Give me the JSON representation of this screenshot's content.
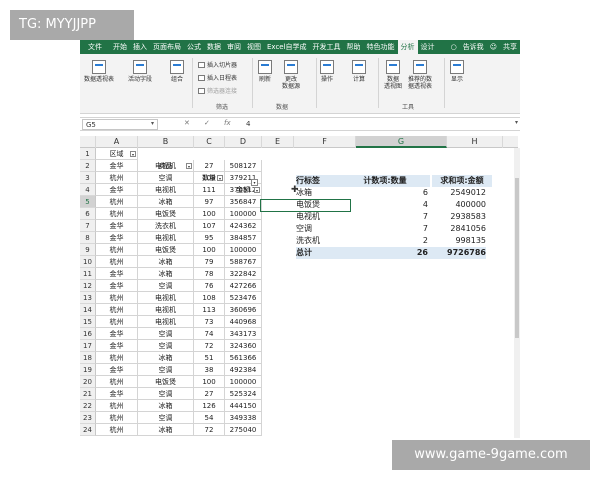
{
  "watermark_top": "TG: MYYJJPP",
  "watermark_bottom": "www.game-9game.com",
  "tabs": [
    "文件",
    "开始",
    "插入",
    "页面布局",
    "公式",
    "数据",
    "审阅",
    "视图",
    "Excel自学成",
    "开发工具",
    "帮助",
    "特色功能",
    "分析",
    "设计"
  ],
  "tab_active": "分析",
  "tab_tell": "告诉我",
  "tab_share": "共享",
  "ribbon": {
    "pivot_table": "数据透视表",
    "active_field": "活动字段",
    "group": "组合",
    "insert_slicer": "插入切片器",
    "insert_timeline": "插入日程表",
    "filter_connections": "筛选器连接",
    "filter_group": "筛选",
    "refresh": "刷新",
    "change_source": "更改\n数据源",
    "data_group": "数据",
    "actions": "操作",
    "calculations": "计算",
    "pivot_chart": "数据\n透视图",
    "recommended": "推荐的数\n据透视表",
    "tools_group": "工具",
    "show": "显示"
  },
  "formula_bar": {
    "name_box": "G5",
    "fx": "fx",
    "value": "4"
  },
  "columns": [
    "A",
    "B",
    "C",
    "D",
    "E",
    "F",
    "G",
    "H"
  ],
  "selected_column": "G",
  "selected_row": "5",
  "headers": {
    "region": "区域",
    "product": "商品",
    "qty": "数量",
    "amount": "金额"
  },
  "rows": [
    {
      "n": "2",
      "region": "金华",
      "product": "电视机",
      "qty": "27",
      "amount": "508127"
    },
    {
      "n": "3",
      "region": "杭州",
      "product": "空调",
      "qty": "109",
      "amount": "379211"
    },
    {
      "n": "4",
      "region": "金华",
      "product": "电视机",
      "qty": "111",
      "amount": "376512"
    },
    {
      "n": "5",
      "region": "杭州",
      "product": "冰箱",
      "qty": "97",
      "amount": "356847"
    },
    {
      "n": "6",
      "region": "杭州",
      "product": "电饭煲",
      "qty": "100",
      "amount": "100000"
    },
    {
      "n": "7",
      "region": "金华",
      "product": "洗衣机",
      "qty": "107",
      "amount": "424362"
    },
    {
      "n": "8",
      "region": "金华",
      "product": "电视机",
      "qty": "95",
      "amount": "384857"
    },
    {
      "n": "9",
      "region": "杭州",
      "product": "电饭煲",
      "qty": "100",
      "amount": "100000"
    },
    {
      "n": "10",
      "region": "杭州",
      "product": "冰箱",
      "qty": "79",
      "amount": "588767"
    },
    {
      "n": "11",
      "region": "金华",
      "product": "冰箱",
      "qty": "78",
      "amount": "322842"
    },
    {
      "n": "12",
      "region": "金华",
      "product": "空调",
      "qty": "76",
      "amount": "427266"
    },
    {
      "n": "13",
      "region": "杭州",
      "product": "电视机",
      "qty": "108",
      "amount": "523476"
    },
    {
      "n": "14",
      "region": "杭州",
      "product": "电视机",
      "qty": "113",
      "amount": "360696"
    },
    {
      "n": "15",
      "region": "杭州",
      "product": "电视机",
      "qty": "73",
      "amount": "440968"
    },
    {
      "n": "16",
      "region": "金华",
      "product": "空调",
      "qty": "74",
      "amount": "343173"
    },
    {
      "n": "17",
      "region": "金华",
      "product": "空调",
      "qty": "72",
      "amount": "324360"
    },
    {
      "n": "18",
      "region": "杭州",
      "product": "冰箱",
      "qty": "51",
      "amount": "561366"
    },
    {
      "n": "19",
      "region": "金华",
      "product": "空调",
      "qty": "38",
      "amount": "492384"
    },
    {
      "n": "20",
      "region": "杭州",
      "product": "电饭煲",
      "qty": "100",
      "amount": "100000"
    },
    {
      "n": "21",
      "region": "金华",
      "product": "空调",
      "qty": "27",
      "amount": "525324"
    },
    {
      "n": "22",
      "region": "杭州",
      "product": "冰箱",
      "qty": "126",
      "amount": "444150"
    },
    {
      "n": "23",
      "region": "杭州",
      "product": "空调",
      "qty": "54",
      "amount": "349338"
    },
    {
      "n": "24",
      "region": "杭州",
      "product": "冰箱",
      "qty": "72",
      "amount": "275040"
    }
  ],
  "pivot": {
    "row_label": "行标签",
    "count_label": "计数项:数量",
    "sum_label": "求和项:金额",
    "items": [
      {
        "label": "冰箱",
        "count": "6",
        "sum": "2549012"
      },
      {
        "label": "电饭煲",
        "count": "4",
        "sum": "400000"
      },
      {
        "label": "电视机",
        "count": "7",
        "sum": "2938583"
      },
      {
        "label": "空调",
        "count": "7",
        "sum": "2841056"
      },
      {
        "label": "洗衣机",
        "count": "2",
        "sum": "998135"
      }
    ],
    "total_label": "总计",
    "total_count": "26",
    "total_sum": "9726786"
  },
  "colors": {
    "accent": "#217346",
    "pivot_header": "#dde9f4"
  }
}
